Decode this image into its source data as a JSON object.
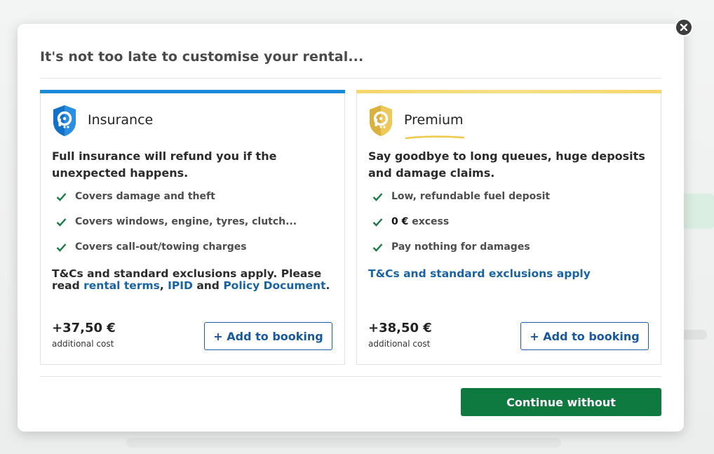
{
  "modal": {
    "title": "It's not too late to customise your rental...",
    "continue_label": "Continue without"
  },
  "colors": {
    "insurance_accent": "#1a8bd9",
    "premium_accent": "#f5d66a",
    "link": "#1763a6",
    "check": "#1a7a45",
    "continue_bg": "#0e7a3f",
    "add_border": "#1a5da8"
  },
  "insurance": {
    "icon": "shield-icon",
    "name": "Insurance",
    "headline": "Full insurance will refund you if the unexpected happens.",
    "features": [
      "Covers damage and theft",
      "Covers windows, engine, tyres, clutch...",
      "Covers call-out/towing charges"
    ],
    "terms_text": "T&Cs and standard exclusions apply. Please read",
    "link_rental_terms": "rental terms",
    "sep_comma": ",",
    "link_ipid": "IPID",
    "sep_and": "and",
    "link_policy": "Policy Document",
    "terms_end": ".",
    "price": "+37,50 €",
    "price_sub": "additional cost",
    "add_label": "+ Add to booking"
  },
  "premium": {
    "icon": "shield-icon",
    "name": "Premium",
    "headline": "Say goodbye to long queues, huge deposits and damage claims.",
    "feature_1": "Low, refundable fuel deposit",
    "feature_2_bold": "0 €",
    "feature_2_rest": "excess",
    "feature_3": "Pay nothing for damages",
    "terms_link": "T&Cs and standard exclusions apply",
    "price": "+38,50 €",
    "price_sub": "additional cost",
    "add_label": "+ Add to booking"
  }
}
